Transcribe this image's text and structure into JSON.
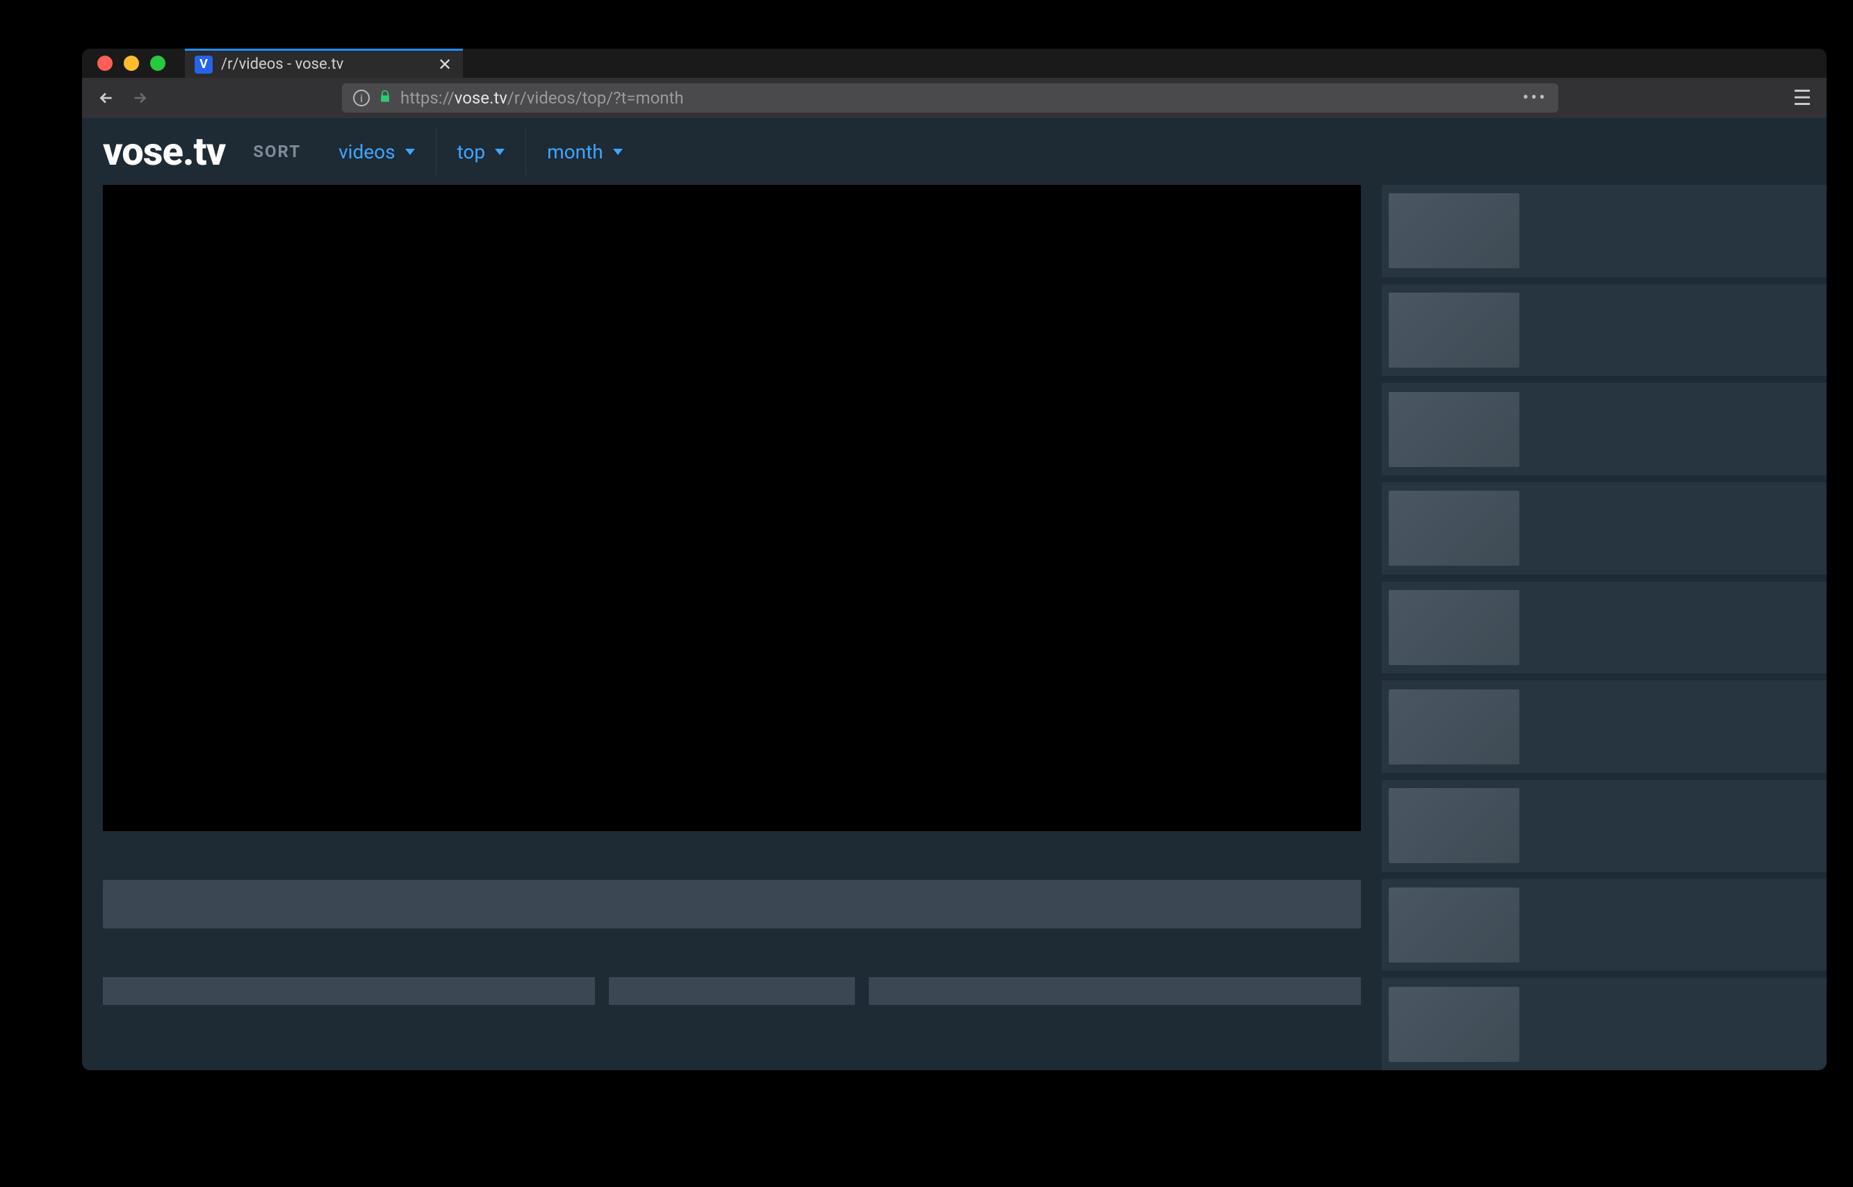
{
  "browser": {
    "tab_title": "/r/videos - vose.tv",
    "favicon_letter": "V",
    "url_scheme": "https://",
    "url_host": "vose.tv",
    "url_path": "/r/videos/top/?t=month",
    "more_actions": "•••",
    "menu_glyph": "☰"
  },
  "app": {
    "brand": "vose.tv",
    "sort_label": "SORT",
    "filters": [
      {
        "label": "videos"
      },
      {
        "label": "top"
      },
      {
        "label": "month"
      }
    ]
  },
  "sidebar_items_count": 9,
  "colors": {
    "accent": "#3ea6ff",
    "page_bg": "#1e2a34",
    "panel_bg": "#273540"
  }
}
